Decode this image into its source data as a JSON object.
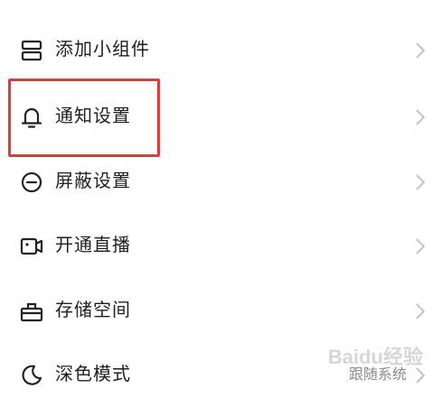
{
  "settings": {
    "items": [
      {
        "label": "添加小组件",
        "icon": "widget-icon"
      },
      {
        "label": "通知设置",
        "icon": "bell-icon"
      },
      {
        "label": "屏蔽设置",
        "icon": "block-icon"
      },
      {
        "label": "开通直播",
        "icon": "live-camera-icon"
      },
      {
        "label": "存储空间",
        "icon": "storage-box-icon"
      },
      {
        "label": "深色模式",
        "icon": "moon-icon",
        "value": "跟随系统"
      }
    ]
  },
  "watermark": "Baidu经验",
  "colors": {
    "highlight": "#e53935",
    "text": "#1f1f1f",
    "secondary": "#8a8a8a",
    "chevron": "#c4c4c4"
  }
}
